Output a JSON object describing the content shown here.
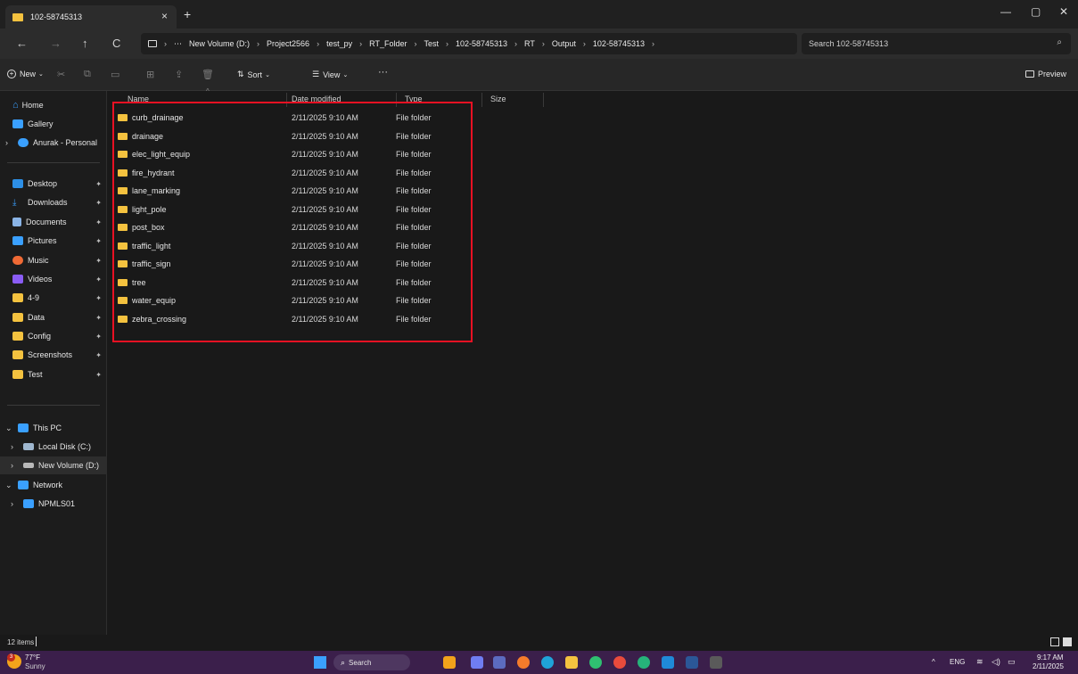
{
  "window": {
    "tab_title": "102-58745313",
    "tab_close": "×",
    "new_tab": "+",
    "minimize": "—",
    "maximize": "▢",
    "close": "✕"
  },
  "nav": {
    "back": "←",
    "forward": "→",
    "up": "↑",
    "refresh": "C"
  },
  "breadcrumb": {
    "more": "⋯",
    "items": [
      "New Volume (D:)",
      "Project2566",
      "test_py",
      "RT_Folder",
      "Test",
      "102-58745313",
      "RT",
      "Output",
      "102-58745313"
    ]
  },
  "search": {
    "placeholder": "Search 102-58745313",
    "icon": "search-icon"
  },
  "commands": {
    "new": "New",
    "sort": "Sort",
    "view": "View",
    "more": "···",
    "preview": "Preview"
  },
  "sidebar": {
    "home": "Home",
    "gallery": "Gallery",
    "onedrive": "Anurak - Personal",
    "pinned": [
      {
        "label": "Desktop",
        "icon": "desktop-icon",
        "color": "#2d8fe6"
      },
      {
        "label": "Downloads",
        "icon": "download-icon",
        "color": "#3aa0ff"
      },
      {
        "label": "Documents",
        "icon": "document-icon",
        "color": "#8ab4e6"
      },
      {
        "label": "Pictures",
        "icon": "pictures-icon",
        "color": "#3aa0ff"
      },
      {
        "label": "Music",
        "icon": "music-icon",
        "color": "#f06a35"
      },
      {
        "label": "Videos",
        "icon": "videos-icon",
        "color": "#8a5cf5"
      },
      {
        "label": "4-9",
        "icon": "folder-icon",
        "color": "#f4c23f"
      },
      {
        "label": "Data",
        "icon": "folder-icon",
        "color": "#f4c23f"
      },
      {
        "label": "Config",
        "icon": "folder-icon",
        "color": "#f4c23f"
      },
      {
        "label": "Screenshots",
        "icon": "folder-icon",
        "color": "#f4c23f"
      },
      {
        "label": "Test",
        "icon": "folder-icon",
        "color": "#f4c23f"
      }
    ],
    "this_pc": "This PC",
    "local_disk": "Local Disk (C:)",
    "new_volume": "New Volume (D:)",
    "network": "Network",
    "npmls": "NPMLS01"
  },
  "columns": {
    "name": "Name",
    "date": "Date modified",
    "type": "Type",
    "size": "Size"
  },
  "files": [
    {
      "name": "curb_drainage",
      "date": "2/11/2025 9:10 AM",
      "type": "File folder"
    },
    {
      "name": "drainage",
      "date": "2/11/2025 9:10 AM",
      "type": "File folder"
    },
    {
      "name": "elec_light_equip",
      "date": "2/11/2025 9:10 AM",
      "type": "File folder"
    },
    {
      "name": "fire_hydrant",
      "date": "2/11/2025 9:10 AM",
      "type": "File folder"
    },
    {
      "name": "lane_marking",
      "date": "2/11/2025 9:10 AM",
      "type": "File folder"
    },
    {
      "name": "light_pole",
      "date": "2/11/2025 9:10 AM",
      "type": "File folder"
    },
    {
      "name": "post_box",
      "date": "2/11/2025 9:10 AM",
      "type": "File folder"
    },
    {
      "name": "traffic_light",
      "date": "2/11/2025 9:10 AM",
      "type": "File folder"
    },
    {
      "name": "traffic_sign",
      "date": "2/11/2025 9:10 AM",
      "type": "File folder"
    },
    {
      "name": "tree",
      "date": "2/11/2025 9:10 AM",
      "type": "File folder"
    },
    {
      "name": "water_equip",
      "date": "2/11/2025 9:10 AM",
      "type": "File folder"
    },
    {
      "name": "zebra_crossing",
      "date": "2/11/2025 9:10 AM",
      "type": "File folder"
    }
  ],
  "status": {
    "count": "12 items"
  },
  "taskbar": {
    "weather_badge": "3",
    "temperature": "77°F",
    "condition": "Sunny",
    "search": "Search",
    "lang": "ENG",
    "tray_chevron": "^",
    "time": "9:17 AM",
    "date": "2/11/2025",
    "accent": "#3b1f4b"
  }
}
